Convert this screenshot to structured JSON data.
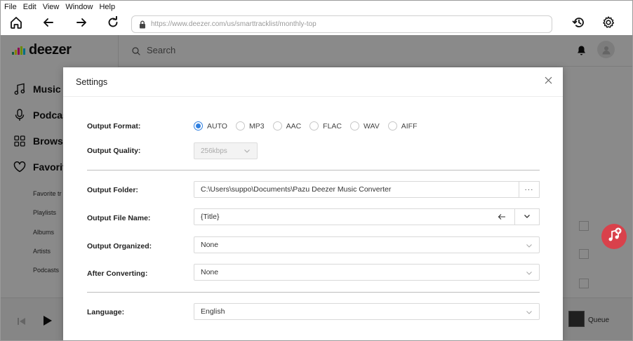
{
  "menubar": {
    "items": [
      "File",
      "Edit",
      "View",
      "Window",
      "Help"
    ]
  },
  "toolbar": {
    "url": "https://www.deezer.com/us/smarttracklist/monthly-top"
  },
  "app": {
    "logo": "deezer",
    "search_placeholder": "Search",
    "nav": {
      "music": "Music",
      "podcasts": "Podcas",
      "browse": "Browse",
      "favorites": "Favorit"
    },
    "sub": [
      "Favorite tr",
      "Playlists",
      "Albums",
      "Artists",
      "Podcasts"
    ],
    "queue": "Queue"
  },
  "settings": {
    "title": "Settings",
    "output_format_label": "Output Format:",
    "formats": [
      "AUTO",
      "MP3",
      "AAC",
      "FLAC",
      "WAV",
      "AIFF"
    ],
    "selected_format": "AUTO",
    "output_quality_label": "Output Quality:",
    "quality_value": "256kbps",
    "output_folder_label": "Output Folder:",
    "output_folder_value": "C:\\Users\\suppo\\Documents\\Pazu Deezer Music Converter",
    "browse_btn": "···",
    "output_file_name_label": "Output File Name:",
    "output_file_name_value": "{Title}",
    "output_organized_label": "Output Organized:",
    "output_organized_value": "None",
    "after_converting_label": "After Converting:",
    "after_converting_value": "None",
    "language_label": "Language:",
    "language_value": "English"
  },
  "colors": {
    "accent": "#2f7fe0",
    "fab": "#d9414b"
  },
  "icons": [
    "home-icon",
    "back-icon",
    "forward-icon",
    "reload-icon",
    "lock-icon",
    "history-icon",
    "gear-icon",
    "search-icon",
    "bell-icon",
    "avatar-icon",
    "music-note-icon",
    "microphone-icon",
    "grid-icon",
    "heart-icon",
    "play-icon",
    "prev-icon",
    "close-icon",
    "chevron-down-icon",
    "arrow-left-icon",
    "add-music-icon"
  ]
}
